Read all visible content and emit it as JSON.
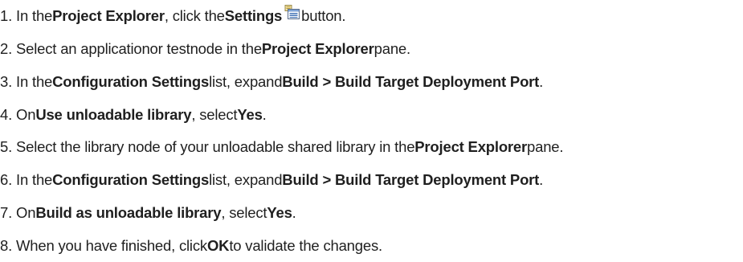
{
  "steps": [
    {
      "num": "1.",
      "parts": [
        "In the",
        "Project Explorer",
        ", click the",
        "Settings",
        "button."
      ]
    },
    {
      "num": "2.",
      "parts": [
        "Select an applicationor testnode in the",
        "Project Explorer",
        "pane."
      ]
    },
    {
      "num": "3.",
      "parts": [
        "In the",
        "Configuration Settings",
        "list, expand",
        "Build > Build Target Deployment Port",
        "."
      ]
    },
    {
      "num": "4.",
      "parts": [
        "On",
        "Use unloadable library",
        ", select",
        "Yes",
        "."
      ]
    },
    {
      "num": "5.",
      "parts": [
        "Select the library node of your unloadable shared library in the",
        "Project Explorer",
        "pane."
      ]
    },
    {
      "num": "6.",
      "parts": [
        "In the",
        "Configuration Settings",
        "list, expand",
        "Build > Build Target Deployment Port",
        "."
      ]
    },
    {
      "num": "7.",
      "parts": [
        "On",
        "Build as unloadable library",
        ", select",
        "Yes",
        "."
      ]
    },
    {
      "num": "8.",
      "parts": [
        "When you have finished, click",
        "OK",
        "to validate the changes."
      ]
    }
  ],
  "icons": {
    "settings": "settings-icon"
  }
}
